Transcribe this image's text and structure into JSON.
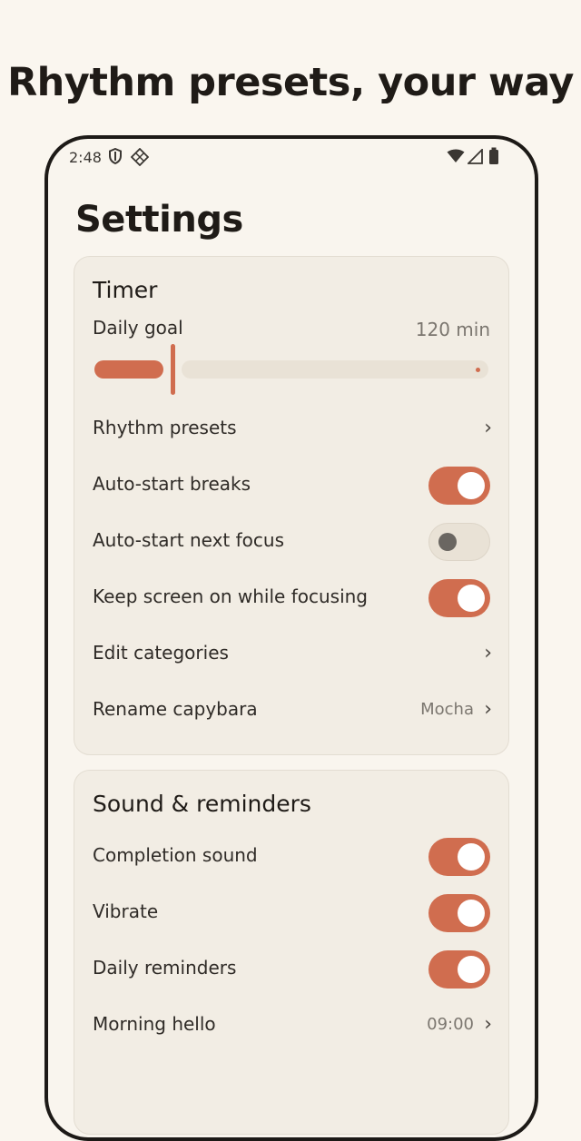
{
  "headline": "Rhythm presets, your way",
  "status_bar": {
    "time": "2:48"
  },
  "page_title": "Settings",
  "timer": {
    "title": "Timer",
    "daily_goal": {
      "label": "Daily goal",
      "value": "120 min",
      "slider_fraction": 0.2
    },
    "rhythm_presets": "Rhythm presets",
    "auto_start_breaks": {
      "label": "Auto-start breaks",
      "on": true
    },
    "auto_start_next_focus": {
      "label": "Auto-start next focus",
      "on": false
    },
    "keep_screen_on": {
      "label": "Keep screen on while focusing",
      "on": true
    },
    "edit_categories": "Edit categories",
    "rename_capybara": {
      "label": "Rename capybara",
      "value": "Mocha"
    }
  },
  "sound": {
    "title": "Sound & reminders",
    "completion_sound": {
      "label": "Completion sound",
      "on": true
    },
    "vibrate": {
      "label": "Vibrate",
      "on": true
    },
    "daily_reminders": {
      "label": "Daily reminders",
      "on": true
    },
    "morning_hello": {
      "label": "Morning hello",
      "value": "09:00"
    }
  },
  "colors": {
    "accent": "#d06d4f",
    "background": "#faf6ef",
    "card": "#f2ede4"
  }
}
